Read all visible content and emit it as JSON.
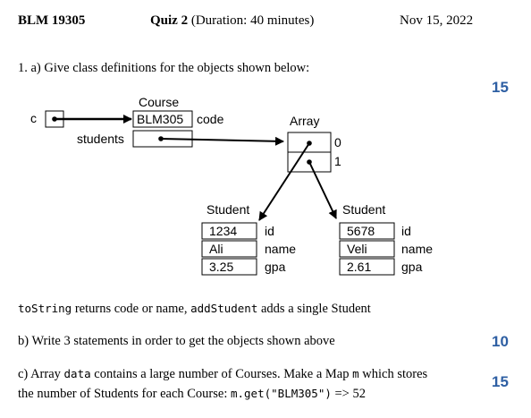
{
  "header": {
    "course_code": "BLM 19305",
    "quiz_title": "Quiz 2",
    "duration": "(Duration: 40 minutes)",
    "date": "Nov 15, 2022"
  },
  "q1": {
    "a_text": "1.  a) Give class definitions for the objects shown below:",
    "a_points": "15",
    "tostring_code": "toString",
    "tostring_text": " returns code or name, ",
    "addstudent_code": "addStudent",
    "addstudent_text": " adds a single Student",
    "b_text": "b) Write 3 statements in order to get the objects shown above",
    "b_points": "10",
    "c_text1": "c) Array ",
    "c_code1": "data",
    "c_text2": " contains a large number of Courses. Make a Map ",
    "c_code2": "m",
    "c_text3": " which stores",
    "c_line2_text": "the number of Students for each Course: ",
    "c_code3": "m.get(\"BLM305\")",
    "c_line2_end": " => 52",
    "c_points": "15"
  },
  "diagram": {
    "var_c": "c",
    "course_label": "Course",
    "course_code_value": "BLM305",
    "course_code_field": "code",
    "course_students_field": "students",
    "array_label": "Array",
    "array_index_0": "0",
    "array_index_1": "1",
    "student1": {
      "label": "Student",
      "id": "1234",
      "name": "Ali",
      "gpa": "3.25"
    },
    "student2": {
      "label": "Student",
      "id": "5678",
      "name": "Veli",
      "gpa": "2.61"
    },
    "field_id": "id",
    "field_name": "name",
    "field_gpa": "gpa"
  }
}
